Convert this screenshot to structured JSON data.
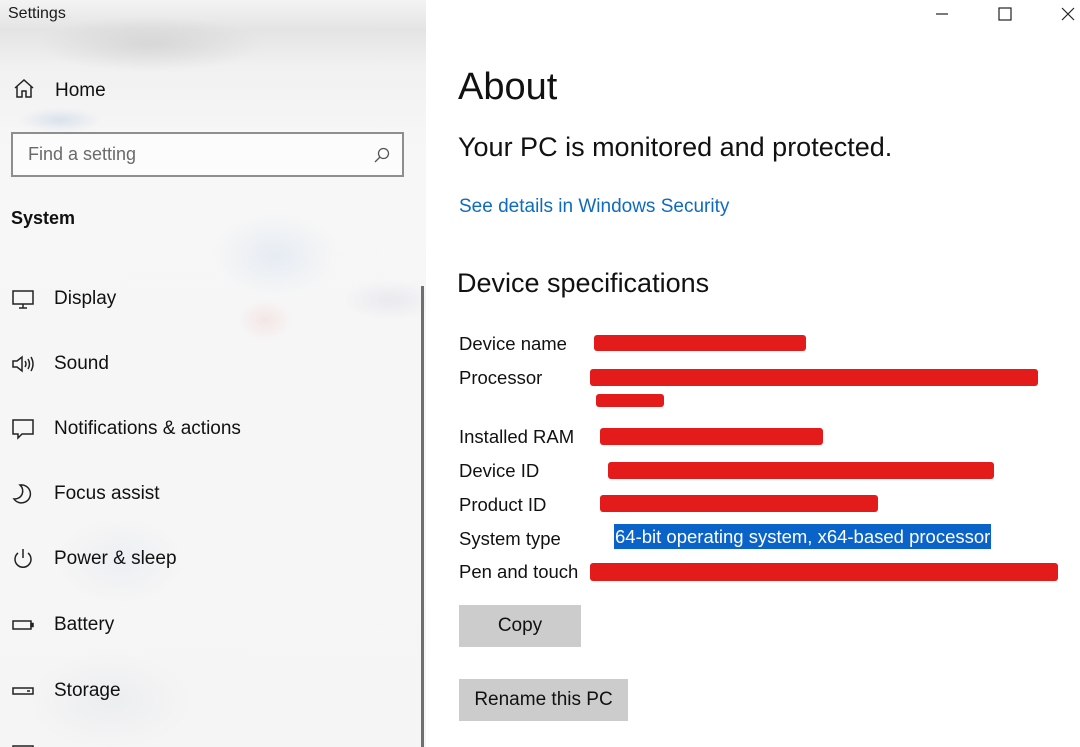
{
  "window": {
    "title": "Settings"
  },
  "sidebar": {
    "home_label": "Home",
    "search_placeholder": "Find a setting",
    "section_title": "System",
    "items": [
      {
        "label": "Display",
        "icon": "monitor-icon"
      },
      {
        "label": "Sound",
        "icon": "speaker-icon"
      },
      {
        "label": "Notifications & actions",
        "icon": "message-icon"
      },
      {
        "label": "Focus assist",
        "icon": "moon-icon"
      },
      {
        "label": "Power & sleep",
        "icon": "power-icon"
      },
      {
        "label": "Battery",
        "icon": "battery-icon"
      },
      {
        "label": "Storage",
        "icon": "storage-icon"
      }
    ]
  },
  "main": {
    "title": "About",
    "protection_message": "Your PC is monitored and protected.",
    "security_link": "See details in Windows Security",
    "specs_title": "Device specifications",
    "specs": [
      {
        "label": "Device name",
        "value_redacted": true
      },
      {
        "label": "Processor",
        "value_redacted": true
      },
      {
        "label": "Installed RAM",
        "value_redacted": true
      },
      {
        "label": "Device ID",
        "value_redacted": true
      },
      {
        "label": "Product ID",
        "value_redacted": true
      },
      {
        "label": "System type",
        "value": "64-bit operating system, x64-based processor",
        "selected": true
      },
      {
        "label": "Pen and touch",
        "value_redacted": true
      }
    ],
    "copy_button": "Copy",
    "rename_button": "Rename this PC"
  },
  "colors": {
    "link": "#0f6cbd",
    "redaction": "#e31b1b",
    "selection": "#0a63c9",
    "button_bg": "#cccccc"
  }
}
